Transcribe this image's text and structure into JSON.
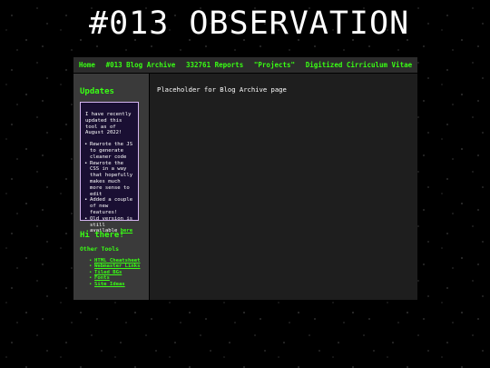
{
  "site_title": "#013 OBSERVATION",
  "nav": {
    "items": [
      {
        "label": "Home"
      },
      {
        "label": "#013 Blog Archive"
      },
      {
        "label": "332761 Reports"
      },
      {
        "label": "\"Projects\""
      },
      {
        "label": "Digitized Cirriculum Vitae"
      }
    ]
  },
  "sidebar": {
    "updates_title": "Updates",
    "updates_intro": "I have recently updated this tool as of August 2022!",
    "updates_items": [
      "Rewrote the JS to generate cleaner code",
      "Rewrote the CSS in a way that hopefully makes much more sense to edit",
      "Added a couple of new features!"
    ],
    "updates_old_text": "Old version is still available",
    "updates_old_link": "here",
    "hi_title": "Hi there!",
    "other_tools_title": "Other Tools",
    "tools": [
      {
        "label": "HTML Cheatsheet"
      },
      {
        "label": "Webmaster Links"
      },
      {
        "label": "Tiled BGs"
      },
      {
        "label": "Fonts"
      },
      {
        "label": "Site Ideas"
      }
    ]
  },
  "main": {
    "text": "Placeholder for Blog Archive page"
  },
  "colors": {
    "accent_green": "#39ff14",
    "updates_box_bg": "#1a0f33",
    "updates_box_border": "#d4b4f0"
  }
}
